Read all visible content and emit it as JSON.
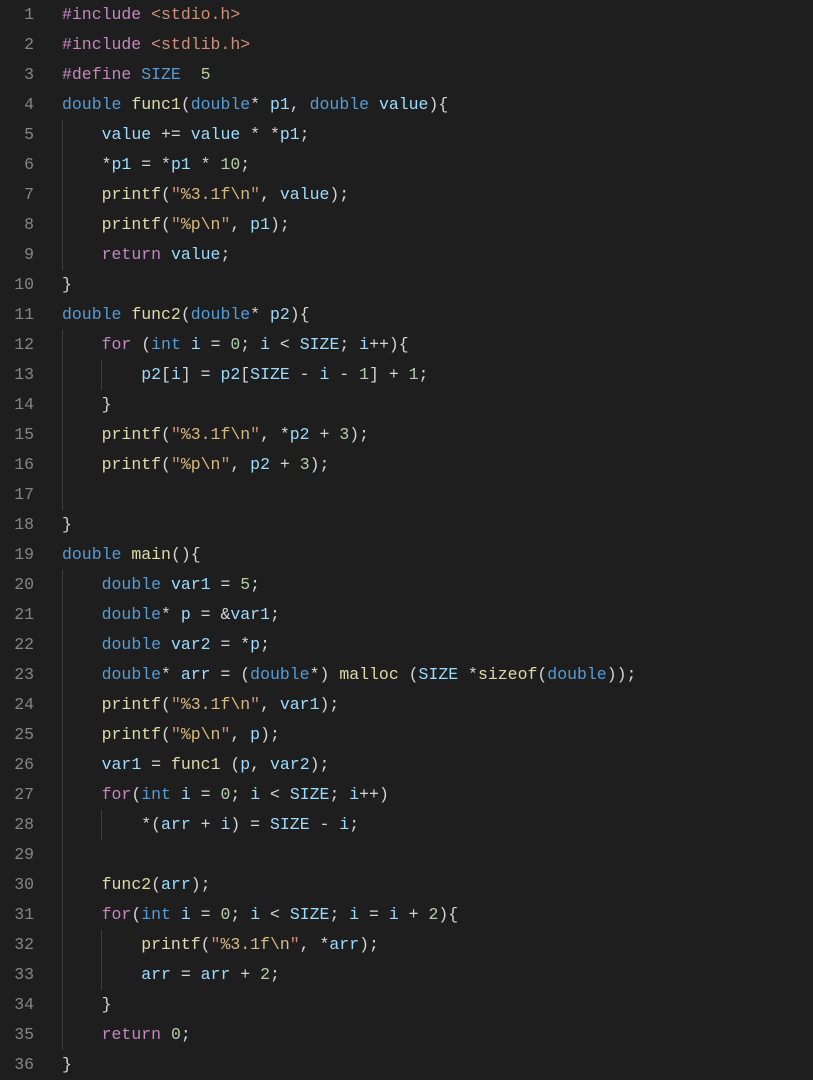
{
  "lines": [
    {
      "n": 1,
      "indent": 0,
      "tokens": [
        [
          "pp",
          "#include"
        ],
        [
          "punc",
          " "
        ],
        [
          "inc",
          "<stdio.h>"
        ]
      ]
    },
    {
      "n": 2,
      "indent": 0,
      "tokens": [
        [
          "pp",
          "#include"
        ],
        [
          "punc",
          " "
        ],
        [
          "inc",
          "<stdlib.h>"
        ]
      ]
    },
    {
      "n": 3,
      "indent": 0,
      "tokens": [
        [
          "pp",
          "#define"
        ],
        [
          "punc",
          " "
        ],
        [
          "def",
          "SIZE"
        ],
        [
          "punc",
          "  "
        ],
        [
          "num",
          "5"
        ]
      ]
    },
    {
      "n": 4,
      "indent": 0,
      "tokens": [
        [
          "kw",
          "double"
        ],
        [
          "punc",
          " "
        ],
        [
          "fn",
          "func1"
        ],
        [
          "punc",
          "("
        ],
        [
          "kw",
          "double"
        ],
        [
          "punc",
          "* "
        ],
        [
          "var",
          "p1"
        ],
        [
          "punc",
          ", "
        ],
        [
          "kw",
          "double"
        ],
        [
          "punc",
          " "
        ],
        [
          "var",
          "value"
        ],
        [
          "punc",
          "){"
        ]
      ]
    },
    {
      "n": 5,
      "indent": 1,
      "tokens": [
        [
          "punc",
          "    "
        ],
        [
          "var",
          "value"
        ],
        [
          "punc",
          " += "
        ],
        [
          "var",
          "value"
        ],
        [
          "punc",
          " * *"
        ],
        [
          "var",
          "p1"
        ],
        [
          "punc",
          ";"
        ]
      ]
    },
    {
      "n": 6,
      "indent": 1,
      "tokens": [
        [
          "punc",
          "    *"
        ],
        [
          "var",
          "p1"
        ],
        [
          "punc",
          " = *"
        ],
        [
          "var",
          "p1"
        ],
        [
          "punc",
          " * "
        ],
        [
          "num",
          "10"
        ],
        [
          "punc",
          ";"
        ]
      ]
    },
    {
      "n": 7,
      "indent": 1,
      "tokens": [
        [
          "punc",
          "    "
        ],
        [
          "fn",
          "printf"
        ],
        [
          "punc",
          "("
        ],
        [
          "str",
          "\""
        ],
        [
          "esc",
          "%3.1f\\n"
        ],
        [
          "str",
          "\""
        ],
        [
          "punc",
          ", "
        ],
        [
          "var",
          "value"
        ],
        [
          "punc",
          ");"
        ]
      ]
    },
    {
      "n": 8,
      "indent": 1,
      "tokens": [
        [
          "punc",
          "    "
        ],
        [
          "fn",
          "printf"
        ],
        [
          "punc",
          "("
        ],
        [
          "str",
          "\""
        ],
        [
          "esc",
          "%p\\n"
        ],
        [
          "str",
          "\""
        ],
        [
          "punc",
          ", "
        ],
        [
          "var",
          "p1"
        ],
        [
          "punc",
          ");"
        ]
      ]
    },
    {
      "n": 9,
      "indent": 1,
      "tokens": [
        [
          "punc",
          "    "
        ],
        [
          "ctl",
          "return"
        ],
        [
          "punc",
          " "
        ],
        [
          "var",
          "value"
        ],
        [
          "punc",
          ";"
        ]
      ]
    },
    {
      "n": 10,
      "indent": 0,
      "tokens": [
        [
          "punc",
          "}"
        ]
      ]
    },
    {
      "n": 11,
      "indent": 0,
      "tokens": [
        [
          "kw",
          "double"
        ],
        [
          "punc",
          " "
        ],
        [
          "fn",
          "func2"
        ],
        [
          "punc",
          "("
        ],
        [
          "kw",
          "double"
        ],
        [
          "punc",
          "* "
        ],
        [
          "var",
          "p2"
        ],
        [
          "punc",
          "){"
        ]
      ]
    },
    {
      "n": 12,
      "indent": 1,
      "tokens": [
        [
          "punc",
          "    "
        ],
        [
          "ctl",
          "for"
        ],
        [
          "punc",
          " ("
        ],
        [
          "kw",
          "int"
        ],
        [
          "punc",
          " "
        ],
        [
          "var",
          "i"
        ],
        [
          "punc",
          " = "
        ],
        [
          "num",
          "0"
        ],
        [
          "punc",
          "; "
        ],
        [
          "var",
          "i"
        ],
        [
          "punc",
          " < "
        ],
        [
          "var",
          "SIZE"
        ],
        [
          "punc",
          "; "
        ],
        [
          "var",
          "i"
        ],
        [
          "punc",
          "++){"
        ]
      ]
    },
    {
      "n": 13,
      "indent": 2,
      "tokens": [
        [
          "punc",
          "        "
        ],
        [
          "var",
          "p2"
        ],
        [
          "punc",
          "["
        ],
        [
          "var",
          "i"
        ],
        [
          "punc",
          "] = "
        ],
        [
          "var",
          "p2"
        ],
        [
          "punc",
          "["
        ],
        [
          "var",
          "SIZE"
        ],
        [
          "punc",
          " - "
        ],
        [
          "var",
          "i"
        ],
        [
          "punc",
          " - "
        ],
        [
          "num",
          "1"
        ],
        [
          "punc",
          "] + "
        ],
        [
          "num",
          "1"
        ],
        [
          "punc",
          ";"
        ]
      ]
    },
    {
      "n": 14,
      "indent": 1,
      "tokens": [
        [
          "punc",
          "    }"
        ]
      ]
    },
    {
      "n": 15,
      "indent": 1,
      "tokens": [
        [
          "punc",
          "    "
        ],
        [
          "fn",
          "printf"
        ],
        [
          "punc",
          "("
        ],
        [
          "str",
          "\""
        ],
        [
          "esc",
          "%3.1f\\n"
        ],
        [
          "str",
          "\""
        ],
        [
          "punc",
          ", *"
        ],
        [
          "var",
          "p2"
        ],
        [
          "punc",
          " + "
        ],
        [
          "num",
          "3"
        ],
        [
          "punc",
          ");"
        ]
      ]
    },
    {
      "n": 16,
      "indent": 1,
      "tokens": [
        [
          "punc",
          "    "
        ],
        [
          "fn",
          "printf"
        ],
        [
          "punc",
          "("
        ],
        [
          "str",
          "\""
        ],
        [
          "esc",
          "%p\\n"
        ],
        [
          "str",
          "\""
        ],
        [
          "punc",
          ", "
        ],
        [
          "var",
          "p2"
        ],
        [
          "punc",
          " + "
        ],
        [
          "num",
          "3"
        ],
        [
          "punc",
          ");"
        ]
      ]
    },
    {
      "n": 17,
      "indent": 1,
      "tokens": [
        [
          "punc",
          ""
        ]
      ]
    },
    {
      "n": 18,
      "indent": 0,
      "tokens": [
        [
          "punc",
          "}"
        ]
      ]
    },
    {
      "n": 19,
      "indent": 0,
      "tokens": [
        [
          "kw",
          "double"
        ],
        [
          "punc",
          " "
        ],
        [
          "fn",
          "main"
        ],
        [
          "punc",
          "(){"
        ]
      ]
    },
    {
      "n": 20,
      "indent": 1,
      "tokens": [
        [
          "punc",
          "    "
        ],
        [
          "kw",
          "double"
        ],
        [
          "punc",
          " "
        ],
        [
          "var",
          "var1"
        ],
        [
          "punc",
          " = "
        ],
        [
          "num",
          "5"
        ],
        [
          "punc",
          ";"
        ]
      ]
    },
    {
      "n": 21,
      "indent": 1,
      "tokens": [
        [
          "punc",
          "    "
        ],
        [
          "kw",
          "double"
        ],
        [
          "punc",
          "* "
        ],
        [
          "var",
          "p"
        ],
        [
          "punc",
          " = &"
        ],
        [
          "var",
          "var1"
        ],
        [
          "punc",
          ";"
        ]
      ]
    },
    {
      "n": 22,
      "indent": 1,
      "tokens": [
        [
          "punc",
          "    "
        ],
        [
          "kw",
          "double"
        ],
        [
          "punc",
          " "
        ],
        [
          "var",
          "var2"
        ],
        [
          "punc",
          " = *"
        ],
        [
          "var",
          "p"
        ],
        [
          "punc",
          ";"
        ]
      ]
    },
    {
      "n": 23,
      "indent": 1,
      "tokens": [
        [
          "punc",
          "    "
        ],
        [
          "kw",
          "double"
        ],
        [
          "punc",
          "* "
        ],
        [
          "var",
          "arr"
        ],
        [
          "punc",
          " = ("
        ],
        [
          "kw",
          "double"
        ],
        [
          "punc",
          "*) "
        ],
        [
          "fn",
          "malloc"
        ],
        [
          "punc",
          " ("
        ],
        [
          "var",
          "SIZE"
        ],
        [
          "punc",
          " *"
        ],
        [
          "fn",
          "sizeof"
        ],
        [
          "punc",
          "("
        ],
        [
          "kw",
          "double"
        ],
        [
          "punc",
          "));"
        ]
      ]
    },
    {
      "n": 24,
      "indent": 1,
      "tokens": [
        [
          "punc",
          "    "
        ],
        [
          "fn",
          "printf"
        ],
        [
          "punc",
          "("
        ],
        [
          "str",
          "\""
        ],
        [
          "esc",
          "%3.1f\\n"
        ],
        [
          "str",
          "\""
        ],
        [
          "punc",
          ", "
        ],
        [
          "var",
          "var1"
        ],
        [
          "punc",
          ");"
        ]
      ]
    },
    {
      "n": 25,
      "indent": 1,
      "tokens": [
        [
          "punc",
          "    "
        ],
        [
          "fn",
          "printf"
        ],
        [
          "punc",
          "("
        ],
        [
          "str",
          "\""
        ],
        [
          "esc",
          "%p\\n"
        ],
        [
          "str",
          "\""
        ],
        [
          "punc",
          ", "
        ],
        [
          "var",
          "p"
        ],
        [
          "punc",
          ");"
        ]
      ]
    },
    {
      "n": 26,
      "indent": 1,
      "tokens": [
        [
          "punc",
          "    "
        ],
        [
          "var",
          "var1"
        ],
        [
          "punc",
          " = "
        ],
        [
          "fn",
          "func1"
        ],
        [
          "punc",
          " ("
        ],
        [
          "var",
          "p"
        ],
        [
          "punc",
          ", "
        ],
        [
          "var",
          "var2"
        ],
        [
          "punc",
          ");"
        ]
      ]
    },
    {
      "n": 27,
      "indent": 1,
      "tokens": [
        [
          "punc",
          "    "
        ],
        [
          "ctl",
          "for"
        ],
        [
          "punc",
          "("
        ],
        [
          "kw",
          "int"
        ],
        [
          "punc",
          " "
        ],
        [
          "var",
          "i"
        ],
        [
          "punc",
          " = "
        ],
        [
          "num",
          "0"
        ],
        [
          "punc",
          "; "
        ],
        [
          "var",
          "i"
        ],
        [
          "punc",
          " < "
        ],
        [
          "var",
          "SIZE"
        ],
        [
          "punc",
          "; "
        ],
        [
          "var",
          "i"
        ],
        [
          "punc",
          "++)"
        ]
      ]
    },
    {
      "n": 28,
      "indent": 2,
      "tokens": [
        [
          "punc",
          "        *("
        ],
        [
          "var",
          "arr"
        ],
        [
          "punc",
          " + "
        ],
        [
          "var",
          "i"
        ],
        [
          "punc",
          ") = "
        ],
        [
          "var",
          "SIZE"
        ],
        [
          "punc",
          " - "
        ],
        [
          "var",
          "i"
        ],
        [
          "punc",
          ";"
        ]
      ]
    },
    {
      "n": 29,
      "indent": 1,
      "tokens": [
        [
          "punc",
          ""
        ]
      ]
    },
    {
      "n": 30,
      "indent": 1,
      "tokens": [
        [
          "punc",
          "    "
        ],
        [
          "fn",
          "func2"
        ],
        [
          "punc",
          "("
        ],
        [
          "var",
          "arr"
        ],
        [
          "punc",
          ");"
        ]
      ]
    },
    {
      "n": 31,
      "indent": 1,
      "tokens": [
        [
          "punc",
          "    "
        ],
        [
          "ctl",
          "for"
        ],
        [
          "punc",
          "("
        ],
        [
          "kw",
          "int"
        ],
        [
          "punc",
          " "
        ],
        [
          "var",
          "i"
        ],
        [
          "punc",
          " = "
        ],
        [
          "num",
          "0"
        ],
        [
          "punc",
          "; "
        ],
        [
          "var",
          "i"
        ],
        [
          "punc",
          " < "
        ],
        [
          "var",
          "SIZE"
        ],
        [
          "punc",
          "; "
        ],
        [
          "var",
          "i"
        ],
        [
          "punc",
          " = "
        ],
        [
          "var",
          "i"
        ],
        [
          "punc",
          " + "
        ],
        [
          "num",
          "2"
        ],
        [
          "punc",
          "){"
        ]
      ]
    },
    {
      "n": 32,
      "indent": 2,
      "tokens": [
        [
          "punc",
          "        "
        ],
        [
          "fn",
          "printf"
        ],
        [
          "punc",
          "("
        ],
        [
          "str",
          "\""
        ],
        [
          "esc",
          "%3.1f\\n"
        ],
        [
          "str",
          "\""
        ],
        [
          "punc",
          ", *"
        ],
        [
          "var",
          "arr"
        ],
        [
          "punc",
          ");"
        ]
      ]
    },
    {
      "n": 33,
      "indent": 2,
      "tokens": [
        [
          "punc",
          "        "
        ],
        [
          "var",
          "arr"
        ],
        [
          "punc",
          " = "
        ],
        [
          "var",
          "arr"
        ],
        [
          "punc",
          " + "
        ],
        [
          "num",
          "2"
        ],
        [
          "punc",
          ";"
        ]
      ]
    },
    {
      "n": 34,
      "indent": 1,
      "tokens": [
        [
          "punc",
          "    }"
        ]
      ]
    },
    {
      "n": 35,
      "indent": 1,
      "tokens": [
        [
          "punc",
          "    "
        ],
        [
          "ctl",
          "return"
        ],
        [
          "punc",
          " "
        ],
        [
          "num",
          "0"
        ],
        [
          "punc",
          ";"
        ]
      ]
    },
    {
      "n": 36,
      "indent": 0,
      "tokens": [
        [
          "punc",
          "}"
        ]
      ]
    }
  ]
}
